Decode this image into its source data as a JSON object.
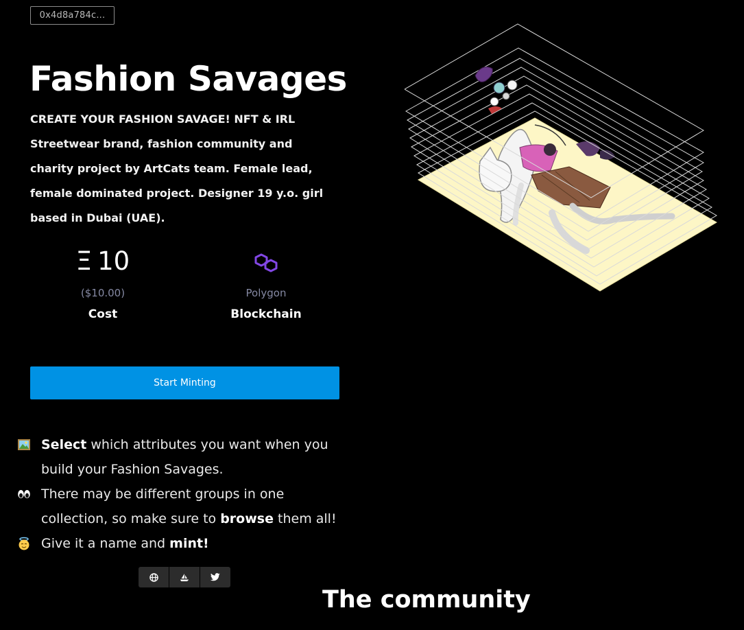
{
  "contract": {
    "address_short": "0x4d8a784c..."
  },
  "project": {
    "title": "Fashion Savages",
    "description": "CREATE YOUR FASHION SAVAGE! NFT & IRL Streetwear brand, fashion community and charity project by ArtCats team. Female lead, female dominated project. Designer 19 y.o. girl based in Dubai (UAE)."
  },
  "stats": {
    "cost": {
      "value": "10",
      "currency_icon": "ethereum-icon",
      "usd": "($10.00)",
      "label": "Cost"
    },
    "blockchain": {
      "name": "Polygon",
      "icon": "polygon-icon",
      "label": "Blockchain"
    }
  },
  "mint_button": {
    "label": "Start Minting"
  },
  "instructions": [
    {
      "icon": "framed-picture-icon",
      "bold": "Select",
      "text": " which attributes you want when you build your Fashion Savages."
    },
    {
      "icon": "eyes-icon",
      "pre": "There may be different groups in one collection, so make sure to ",
      "bold": "browse",
      "post": " them all!"
    },
    {
      "icon": "angel-face-icon",
      "pre": "Give it a name and ",
      "bold": "mint!"
    }
  ],
  "social": [
    {
      "icon": "globe-icon",
      "name": "website"
    },
    {
      "icon": "opensea-boat-icon",
      "name": "opensea"
    },
    {
      "icon": "twitter-icon",
      "name": "twitter"
    }
  ],
  "community": {
    "heading": "The community"
  },
  "colors": {
    "background": "#000000",
    "accent": "#0092e4",
    "muted": "#8589a3",
    "polygon": "#8247e5",
    "preview_base": "#fdf6c6"
  }
}
